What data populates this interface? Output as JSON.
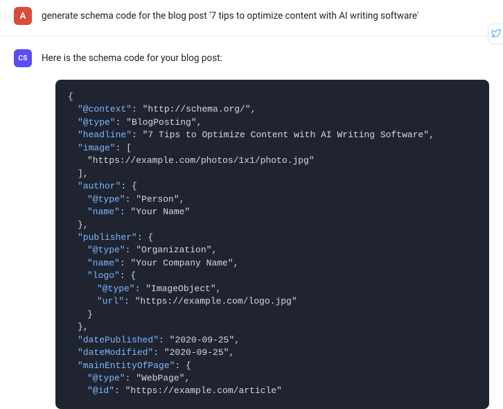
{
  "user": {
    "avatar_label": "A",
    "message": "generate schema code for the blog post '7 tips to optimize content with AI writing software'"
  },
  "assistant": {
    "avatar_label": "CS",
    "intro": "Here is the schema code for your blog post:"
  },
  "code": {
    "lines": [
      {
        "indent": 0,
        "segments": [
          {
            "t": "{",
            "c": "punct"
          }
        ]
      },
      {
        "indent": 1,
        "segments": [
          {
            "t": "\"@context\"",
            "c": "key"
          },
          {
            "t": ": ",
            "c": "punct"
          },
          {
            "t": "\"http://schema.org/\"",
            "c": "string"
          },
          {
            "t": ",",
            "c": "punct"
          }
        ]
      },
      {
        "indent": 1,
        "segments": [
          {
            "t": "\"@type\"",
            "c": "key"
          },
          {
            "t": ": ",
            "c": "punct"
          },
          {
            "t": "\"BlogPosting\"",
            "c": "string"
          },
          {
            "t": ",",
            "c": "punct"
          }
        ]
      },
      {
        "indent": 1,
        "segments": [
          {
            "t": "\"headline\"",
            "c": "key"
          },
          {
            "t": ": ",
            "c": "punct"
          },
          {
            "t": "\"7 Tips to Optimize Content with AI Writing Software\"",
            "c": "string"
          },
          {
            "t": ",",
            "c": "punct"
          }
        ]
      },
      {
        "indent": 1,
        "segments": [
          {
            "t": "\"image\"",
            "c": "key"
          },
          {
            "t": ": [",
            "c": "punct"
          }
        ]
      },
      {
        "indent": 2,
        "segments": [
          {
            "t": "\"https://example.com/photos/1x1/photo.jpg\"",
            "c": "string"
          }
        ]
      },
      {
        "indent": 1,
        "segments": [
          {
            "t": "],",
            "c": "punct"
          }
        ]
      },
      {
        "indent": 1,
        "segments": [
          {
            "t": "\"author\"",
            "c": "key"
          },
          {
            "t": ": {",
            "c": "punct"
          }
        ]
      },
      {
        "indent": 2,
        "segments": [
          {
            "t": "\"@type\"",
            "c": "key"
          },
          {
            "t": ": ",
            "c": "punct"
          },
          {
            "t": "\"Person\"",
            "c": "string"
          },
          {
            "t": ",",
            "c": "punct"
          }
        ]
      },
      {
        "indent": 2,
        "segments": [
          {
            "t": "\"name\"",
            "c": "key"
          },
          {
            "t": ": ",
            "c": "punct"
          },
          {
            "t": "\"Your Name\"",
            "c": "string"
          }
        ]
      },
      {
        "indent": 1,
        "segments": [
          {
            "t": "},",
            "c": "punct"
          }
        ]
      },
      {
        "indent": 1,
        "segments": [
          {
            "t": "\"publisher\"",
            "c": "key"
          },
          {
            "t": ": {",
            "c": "punct"
          }
        ]
      },
      {
        "indent": 2,
        "segments": [
          {
            "t": "\"@type\"",
            "c": "key"
          },
          {
            "t": ": ",
            "c": "punct"
          },
          {
            "t": "\"Organization\"",
            "c": "string"
          },
          {
            "t": ",",
            "c": "punct"
          }
        ]
      },
      {
        "indent": 2,
        "segments": [
          {
            "t": "\"name\"",
            "c": "key"
          },
          {
            "t": ": ",
            "c": "punct"
          },
          {
            "t": "\"Your Company Name\"",
            "c": "string"
          },
          {
            "t": ",",
            "c": "punct"
          }
        ]
      },
      {
        "indent": 2,
        "segments": [
          {
            "t": "\"logo\"",
            "c": "key"
          },
          {
            "t": ": {",
            "c": "punct"
          }
        ]
      },
      {
        "indent": 3,
        "segments": [
          {
            "t": "\"@type\"",
            "c": "key"
          },
          {
            "t": ": ",
            "c": "punct"
          },
          {
            "t": "\"ImageObject\"",
            "c": "string"
          },
          {
            "t": ",",
            "c": "punct"
          }
        ]
      },
      {
        "indent": 3,
        "segments": [
          {
            "t": "\"url\"",
            "c": "key"
          },
          {
            "t": ": ",
            "c": "punct"
          },
          {
            "t": "\"https://example.com/logo.jpg\"",
            "c": "string"
          }
        ]
      },
      {
        "indent": 2,
        "segments": [
          {
            "t": "}",
            "c": "punct"
          }
        ]
      },
      {
        "indent": 1,
        "segments": [
          {
            "t": "},",
            "c": "punct"
          }
        ]
      },
      {
        "indent": 1,
        "segments": [
          {
            "t": "\"datePublished\"",
            "c": "key"
          },
          {
            "t": ": ",
            "c": "punct"
          },
          {
            "t": "\"2020-09-25\"",
            "c": "string"
          },
          {
            "t": ",",
            "c": "punct"
          }
        ]
      },
      {
        "indent": 1,
        "segments": [
          {
            "t": "\"dateModified\"",
            "c": "key"
          },
          {
            "t": ": ",
            "c": "punct"
          },
          {
            "t": "\"2020-09-25\"",
            "c": "string"
          },
          {
            "t": ",",
            "c": "punct"
          }
        ]
      },
      {
        "indent": 1,
        "segments": [
          {
            "t": "\"mainEntityOfPage\"",
            "c": "key"
          },
          {
            "t": ": {",
            "c": "punct"
          }
        ]
      },
      {
        "indent": 2,
        "segments": [
          {
            "t": "\"@type\"",
            "c": "key"
          },
          {
            "t": ": ",
            "c": "punct"
          },
          {
            "t": "\"WebPage\"",
            "c": "string"
          },
          {
            "t": ",",
            "c": "punct"
          }
        ]
      },
      {
        "indent": 2,
        "segments": [
          {
            "t": "\"@id\"",
            "c": "key"
          },
          {
            "t": ": ",
            "c": "punct"
          },
          {
            "t": "\"https://example.com/article\"",
            "c": "string"
          }
        ]
      }
    ]
  },
  "side_tab": {
    "icon": "twitter-icon",
    "color": "#5bb5f0"
  }
}
